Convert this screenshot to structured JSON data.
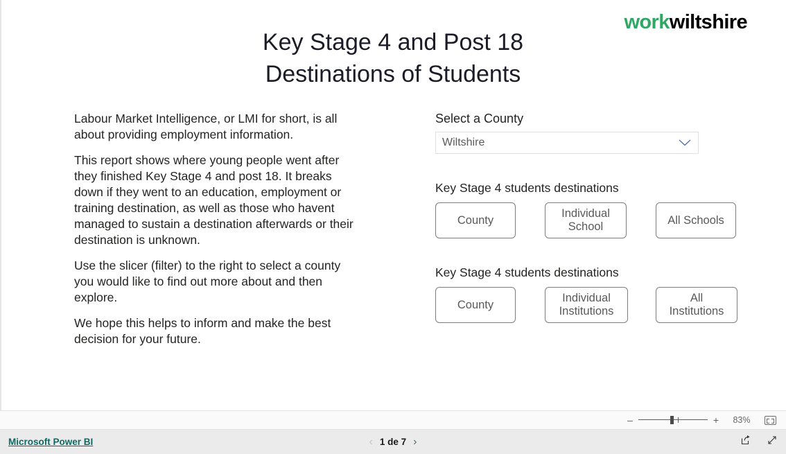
{
  "logo": {
    "part1": "work",
    "part2": "wiltshire",
    "color1": "#2fa864",
    "color2": "#000000"
  },
  "report": {
    "title_line1": "Key Stage 4 and Post 18",
    "title_line2": "Destinations of Students",
    "paragraphs": [
      "Labour Market Intelligence, or LMI for short, is all about providing employment information.",
      "This report shows where young people went after they finished Key Stage 4 and post 18. It breaks down if they went to an education, employment or training destination, as well as those who havent managed to sustain a destination afterwards or their destination is unknown.",
      "Use the slicer (filter) to the right to select a county you would like to find out more about and then explore.",
      "We hope this helps to inform and make the best decision for your future."
    ],
    "slicer": {
      "label": "Select a County",
      "value": "Wiltshire",
      "chevron_icon": "chevron-down-icon"
    },
    "groups": [
      {
        "heading": "Key Stage 4 students destinations",
        "buttons": [
          {
            "line1": "County",
            "line2": ""
          },
          {
            "line1": "Individual",
            "line2": "School"
          },
          {
            "line1": "All Schools",
            "line2": ""
          }
        ]
      },
      {
        "heading": "Key Stage 4 students destinations",
        "buttons": [
          {
            "line1": "County",
            "line2": ""
          },
          {
            "line1": "Individual",
            "line2": "Institutions"
          },
          {
            "line1": "All",
            "line2": "Institutions"
          }
        ]
      }
    ]
  },
  "zoombar": {
    "minus": "–",
    "plus": "+",
    "percent": "83%",
    "fit_icon": "fit-to-screen-icon",
    "slider_position_percent": 46
  },
  "footer": {
    "brand_link": "Microsoft Power BI",
    "brand_link_color": "#0d6b63",
    "prev_icon": "chevron-left-icon",
    "next_icon": "chevron-right-icon",
    "page_text": "1 de 7",
    "share_icon": "share-icon",
    "fullscreen_icon": "fullscreen-icon"
  }
}
